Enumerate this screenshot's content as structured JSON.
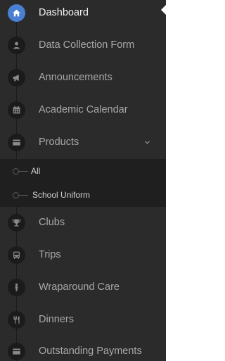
{
  "colors": {
    "sidebar_bg": "#2b2b2b",
    "submenu_bg": "#1f1f1f",
    "active_icon_bg": "#4a7fd1",
    "icon_bg": "#1b1b1b",
    "label": "#a8a8a8",
    "active_label": "#f2f2f2"
  },
  "menu": {
    "active": "Dashboard",
    "items": [
      {
        "label": "Dashboard",
        "icon": "home-icon"
      },
      {
        "label": "Data Collection Form",
        "icon": "user-icon"
      },
      {
        "label": "Announcements",
        "icon": "megaphone-icon"
      },
      {
        "label": "Academic Calendar",
        "icon": "calendar-icon"
      },
      {
        "label": "Products",
        "icon": "credit-card-icon",
        "expanded": true
      },
      {
        "label": "Clubs",
        "icon": "trophy-icon"
      },
      {
        "label": "Trips",
        "icon": "bus-icon"
      },
      {
        "label": "Wraparound Care",
        "icon": "child-icon"
      },
      {
        "label": "Dinners",
        "icon": "cutlery-icon"
      },
      {
        "label": "Outstanding Payments",
        "icon": "credit-card-icon"
      }
    ],
    "products_submenu": [
      {
        "label": "All"
      },
      {
        "label": "School Uniform"
      }
    ]
  }
}
